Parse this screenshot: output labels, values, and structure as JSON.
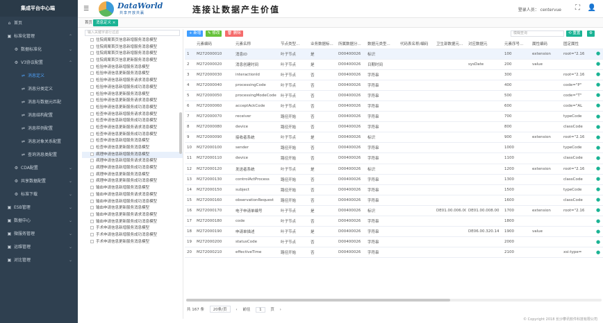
{
  "app": {
    "title": "集成平台中心端"
  },
  "header": {
    "logo_text": "DataWorld",
    "logo_sub": "共享开放共赢",
    "slogan": "连接让数据产生价值",
    "login_label": "登录人员：",
    "login_user": "centervue"
  },
  "tabs": {
    "home": "首页",
    "current": "消息定义 ×"
  },
  "sidebar": {
    "items": [
      {
        "label": "首页",
        "icon": "⌂",
        "level": 1,
        "arrow": ""
      },
      {
        "label": "标准化管理",
        "icon": "▣",
        "level": 1,
        "arrow": "⌃"
      },
      {
        "label": "数据标准化",
        "icon": "⚙",
        "level": 2,
        "arrow": "⌄"
      },
      {
        "label": "V3协议配置",
        "icon": "⚙",
        "level": 2,
        "arrow": "⌃"
      },
      {
        "label": "消息定义",
        "icon": "⇌",
        "level": 3,
        "arrow": "",
        "active": true
      },
      {
        "label": "消息分类定义",
        "icon": "⇌",
        "level": 3,
        "arrow": ""
      },
      {
        "label": "消息与数据元匹配",
        "icon": "⇌",
        "level": 3,
        "arrow": ""
      },
      {
        "label": "消息结构配置",
        "icon": "⇌",
        "level": 3,
        "arrow": ""
      },
      {
        "label": "消息样例配置",
        "icon": "⇌",
        "level": 3,
        "arrow": ""
      },
      {
        "label": "消息对象关系配置",
        "icon": "⇌",
        "level": 3,
        "arrow": ""
      },
      {
        "label": "查询消息类配置",
        "icon": "⇌",
        "level": 3,
        "arrow": ""
      },
      {
        "label": "CDA配置",
        "icon": "⚙",
        "level": 2,
        "arrow": "⌄"
      },
      {
        "label": "共享数据配置",
        "icon": "⚙",
        "level": 2,
        "arrow": "⌄"
      },
      {
        "label": "标准下载",
        "icon": "⚙",
        "level": 2,
        "arrow": "⌄"
      },
      {
        "label": "ESB管理",
        "icon": "▣",
        "level": 1,
        "arrow": "⌄"
      },
      {
        "label": "数据中心",
        "icon": "▣",
        "level": 1,
        "arrow": "⌄"
      },
      {
        "label": "微服务管理",
        "icon": "▣",
        "level": 1,
        "arrow": "⌄"
      },
      {
        "label": "运维管理",
        "icon": "▣",
        "level": 1,
        "arrow": "⌄"
      },
      {
        "label": "对比管理",
        "icon": "▣",
        "level": 1,
        "arrow": "⌄"
      }
    ]
  },
  "tree": {
    "placeholder": "输入关键字进行过滤",
    "rows": [
      "住院病案首页信息新增服务消息模型",
      "住院病案首页信息新增服务消息模型",
      "住院病案首页信息新增服务消息模型",
      "住院病案首页信息更新服务消息模型",
      "检验申请信息新增服务消息模型",
      "检验申请信息更新服务消息模型",
      "检验申请信息新增服务请求消息模型",
      "检验申请信息新增服务成功消息模型",
      "检验申请信息更新服务消息模型",
      "检验申请信息更新服务请求消息模型",
      "检验申请信息更新服务成功消息模型",
      "检查申请信息新增服务请求消息模型",
      "检查申请信息新增服务成功消息模型",
      "检查申请信息更新服务请求消息模型",
      "检查申请信息更新服务成功消息模型",
      "检查申请信息新增服务消息模型",
      "检查申请信息更新服务消息模型",
      "病理申请信息新增服务消息模型",
      "病理申请信息新增服务请求消息模型",
      "病理申请信息新增服务成功消息模型",
      "病理申请信息更新服务消息模型",
      "病理申请信息更新服务成功消息模型",
      "输血申请信息新增服务消息模型",
      "输血申请信息新增服务请求消息模型",
      "输血申请信息新增服务成功消息模型",
      "输血申请信息更新服务消息模型",
      "输血申请信息更新服务请求消息模型",
      "输血申请信息更新服务成功消息模型",
      "手术申请信息新增服务消息模型",
      "手术申请信息新增服务成功消息模型",
      "手术申请信息更新服务消息模型"
    ],
    "selected": 17
  },
  "toolbar": {
    "add": "+ 新增",
    "edit": "✎ 修改",
    "delete": "🗑 删除",
    "search_placeholder": "模糊查询",
    "clear": "⟲ 重置",
    "settings": "⚙"
  },
  "table": {
    "headers": [
      "",
      "元素编码",
      "元素名称",
      "节点类型...",
      "业务数据标...",
      "所属数据分...",
      "数据元类型...",
      "代码表名称/编码",
      "卫生部数据元...",
      "对应数据元",
      "元素序号...",
      "属性编码",
      "固定属性"
    ],
    "rows": [
      [
        "1",
        "M272000010",
        "消息ID",
        "叶子节点",
        "是",
        "D00400026",
        "标识",
        "",
        "",
        "",
        "100",
        "extension",
        "root=\"2.16"
      ],
      [
        "2",
        "M272000020",
        "消息创建时间",
        "叶子节点",
        "是",
        "D00400026",
        "日期时间",
        "",
        "",
        "sysDate",
        "200",
        "value",
        ""
      ],
      [
        "3",
        "M272000030",
        "interactionId",
        "叶子节点",
        "否",
        "D00400026",
        "字符串",
        "",
        "",
        "",
        "300",
        "",
        "root=\"2.16"
      ],
      [
        "4",
        "M272000040",
        "processingCode",
        "叶子节点",
        "否",
        "D00400026",
        "字符串",
        "",
        "",
        "",
        "400",
        "",
        "code=\"P\""
      ],
      [
        "5",
        "M272000050",
        "processingModeCode",
        "叶子节点",
        "否",
        "D00400026",
        "字符串",
        "",
        "",
        "",
        "500",
        "",
        "code=\"T\""
      ],
      [
        "6",
        "M272000060",
        "acceptAckCode",
        "叶子节点",
        "否",
        "D00400026",
        "字符串",
        "",
        "",
        "",
        "600",
        "",
        "code=\"AL"
      ],
      [
        "7",
        "M272000070",
        "receiver",
        "路径开始",
        "否",
        "D00400026",
        "字符串",
        "",
        "",
        "",
        "700",
        "",
        "typeCode"
      ],
      [
        "8",
        "M272000080",
        "device",
        "路径开始",
        "否",
        "D00400026",
        "字符串",
        "",
        "",
        "",
        "800",
        "",
        "classCode"
      ],
      [
        "9",
        "M272000090",
        "接收者系统",
        "叶子节点",
        "是",
        "D00400026",
        "标识",
        "",
        "",
        "",
        "900",
        "extension",
        "root=\"2.16"
      ],
      [
        "10",
        "M272000100",
        "sender",
        "路径开始",
        "否",
        "D00400026",
        "字符串",
        "",
        "",
        "",
        "1000",
        "",
        "typeCode"
      ],
      [
        "11",
        "M272000110",
        "device",
        "路径开始",
        "否",
        "D00400026",
        "字符串",
        "",
        "",
        "",
        "1100",
        "",
        "classCode"
      ],
      [
        "12",
        "M272000120",
        "发送者系统",
        "叶子节点",
        "是",
        "D00400026",
        "标识",
        "",
        "",
        "",
        "1200",
        "extension",
        "root=\"2.16"
      ],
      [
        "13",
        "M272000130",
        "controlActProcess",
        "路径开始",
        "否",
        "D00400026",
        "字符串",
        "",
        "",
        "",
        "1300",
        "",
        "classCode"
      ],
      [
        "14",
        "M272000150",
        "subject",
        "路径开始",
        "否",
        "D00400026",
        "字符串",
        "",
        "",
        "",
        "1500",
        "",
        "typeCode"
      ],
      [
        "15",
        "M272000160",
        "observationRequest",
        "路径开始",
        "否",
        "D00400026",
        "字符串",
        "",
        "",
        "",
        "1600",
        "",
        "classCode"
      ],
      [
        "16",
        "M272000170",
        "电子申请单编号",
        "叶子节点",
        "是",
        "D00400026",
        "标识",
        "",
        "DE01.00.006.00",
        "DE01.00.008.00",
        "1700",
        "extension",
        "root=\"2.16"
      ],
      [
        "17",
        "M272000180",
        "code",
        "叶子节点",
        "否",
        "D00400026",
        "字符串",
        "",
        "",
        "",
        "1800",
        "",
        ""
      ],
      [
        "18",
        "M272000190",
        "申请单描述",
        "叶子节点",
        "是",
        "D00400026",
        "字符串",
        "",
        "",
        "DE06.00.320.14",
        "1900",
        "value",
        ""
      ],
      [
        "19",
        "M272000200",
        "statusCode",
        "叶子节点",
        "否",
        "D00400026",
        "字符串",
        "",
        "",
        "",
        "2000",
        "",
        ""
      ],
      [
        "20",
        "M272000210",
        "effectiveTime",
        "路径开始",
        "否",
        "D00400026",
        "字符串",
        "",
        "",
        "",
        "2100",
        "",
        "xsi:type="
      ]
    ]
  },
  "pager": {
    "total": "共 167 条",
    "size": "20条/页",
    "prev": "‹",
    "prev_text": "前往",
    "page": "1",
    "next": "页",
    "last": "›"
  },
  "footer": {
    "copyright": "© Copyright 2018 长沙攀讯软件科技有限公司"
  }
}
